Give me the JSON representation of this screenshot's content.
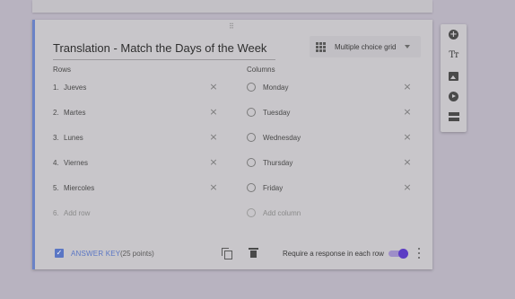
{
  "question": {
    "title": "Translation - Match the Days of the Week",
    "type_label": "Multiple choice grid",
    "drag_handle": "⠿"
  },
  "rows": {
    "header": "Rows",
    "items": [
      {
        "num": "1.",
        "label": "Jueves"
      },
      {
        "num": "2.",
        "label": "Martes"
      },
      {
        "num": "3.",
        "label": "Lunes"
      },
      {
        "num": "4.",
        "label": "Viernes"
      },
      {
        "num": "5.",
        "label": "Miercoles"
      }
    ],
    "add": {
      "num": "6.",
      "label": "Add row"
    }
  },
  "columns": {
    "header": "Columns",
    "items": [
      {
        "label": "Monday"
      },
      {
        "label": "Tuesday"
      },
      {
        "label": "Wednesday"
      },
      {
        "label": "Thursday"
      },
      {
        "label": "Friday"
      }
    ],
    "add": {
      "label": "Add column"
    }
  },
  "footer": {
    "answer_key": "ANSWER KEY",
    "points": "(25 points)",
    "require_label": "Require a response in each row",
    "require_on": true
  },
  "icons": {
    "close": "×",
    "check": "✓",
    "add": "+",
    "text": "Tт"
  },
  "colors": {
    "accent": "#5a76c4",
    "toggle": "#5b3cc4"
  }
}
